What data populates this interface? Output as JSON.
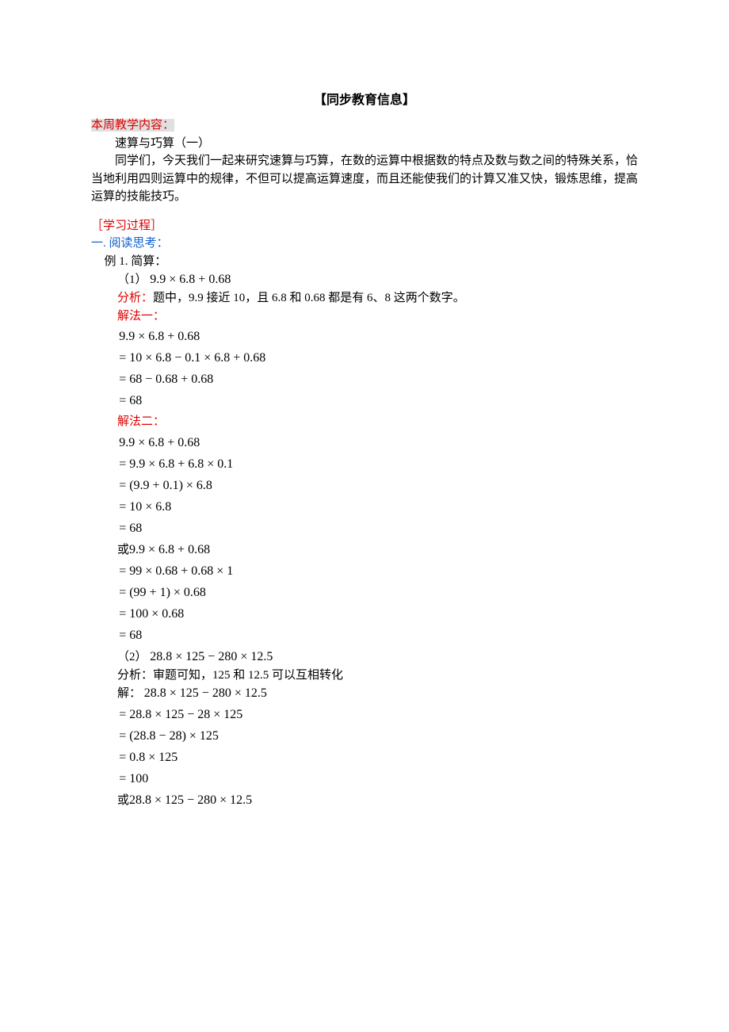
{
  "title": "【同步教育信息】",
  "label_content": "本周教学内容：",
  "topic": "速算与巧算（一）",
  "intro": "同学们，今天我们一起来研究速算与巧算，在数的运算中根据数的特点及数与数之间的特殊关系，恰当地利用四则运算中的规律，不但可以提高运算速度，而且还能使我们的计算又准又快，锻炼思维，提高运算的技能技巧。",
  "label_process": "［学习过程］",
  "section_a": "一. 阅读思考：",
  "ex1": "例 1. 简算：",
  "ex1_1_label": "（1）",
  "ex1_1_expr": "9.9 × 6.8 + 0.68",
  "analysis_label": "分析：",
  "analysis_1": "题中，9.9 接近 10，且 6.8 和 0.68 都是有 6、8 这两个数字。",
  "method1_label": "解法一：",
  "m1_l1": "9.9 × 6.8 + 0.68",
  "m1_l2": "= 10 × 6.8 − 0.1 × 6.8 + 0.68",
  "m1_l3": "= 68 − 0.68 + 0.68",
  "m1_l4": "= 68",
  "method2_label": "解法二：",
  "m2_l1": "9.9 × 6.8 + 0.68",
  "m2_l2": "= 9.9 × 6.8 + 6.8 × 0.1",
  "m2_l3": "= (9.9 + 0.1) × 6.8",
  "m2_l4": "= 10 × 6.8",
  "m2_l5": "= 68",
  "or_label": "或",
  "m2b_l1": "9.9 × 6.8 + 0.68",
  "m2b_l2": "= 99 × 0.68 + 0.68 × 1",
  "m2b_l3": "= (99 + 1) × 0.68",
  "m2b_l4": "= 100 × 0.68",
  "m2b_l5": "= 68",
  "ex1_2_label": "（2）",
  "ex1_2_expr": "28.8 × 125 − 280 × 12.5",
  "analysis_2": "分析：审题可知，125 和 12.5 可以互相转化",
  "solve_label": "解：",
  "s2_expr": "28.8 × 125 − 280 × 12.5",
  "s2_l1": "= 28.8 × 125 − 28 × 125",
  "s2_l2": "= (28.8 − 28) × 125",
  "s2_l3": "= 0.8 × 125",
  "s2_l4": "= 100",
  "s2b_l1": "28.8 × 125 − 280 × 12.5"
}
